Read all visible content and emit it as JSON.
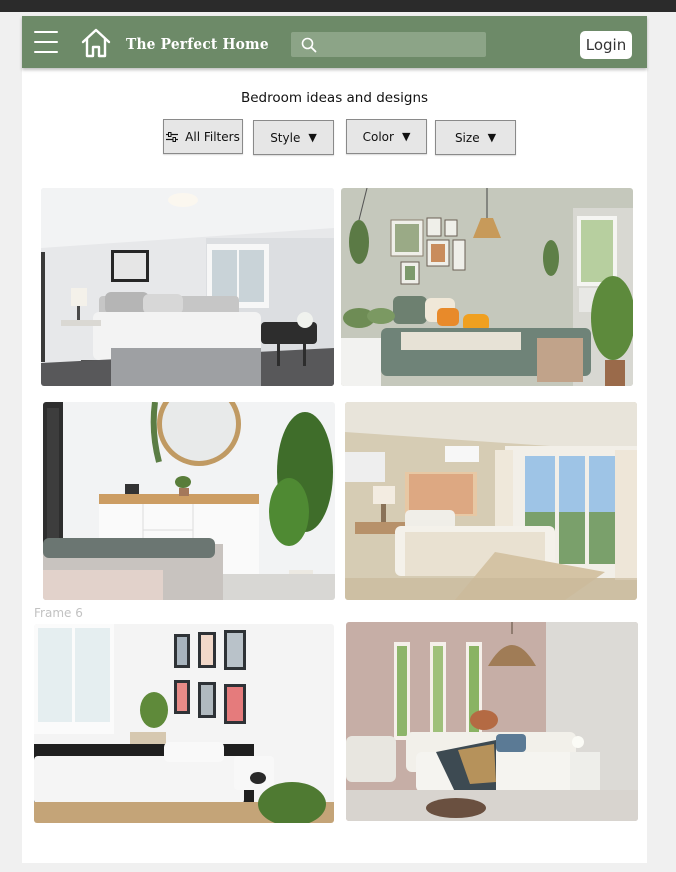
{
  "navbar": {
    "brand": "The Perfect Home",
    "search_placeholder": "",
    "login_label": "Login",
    "icons": [
      "hamburger-menu-icon",
      "home-icon",
      "search-icon"
    ]
  },
  "main": {
    "heading": "Bedroom ideas and designs"
  },
  "filters": {
    "all_filters": "All Filters",
    "style": "Style",
    "color": "Color",
    "size": "Size",
    "caret": "▼"
  },
  "gallery": {
    "images": [
      "bedroom-photo-white-minimal",
      "bedroom-photo-gallery-wall-plants",
      "bedroom-photo-mirror-dresser",
      "bedroom-photo-large-windows",
      "bedroom-photo-framed-prints",
      "bedroom-photo-pink-wall-pendant"
    ]
  },
  "frame_label": "Frame 6",
  "colors": {
    "navbar": "#6d8a68",
    "search_bg": "#8ca487",
    "page_bg": "#ffffff",
    "button_bg": "#e6e6e6"
  }
}
